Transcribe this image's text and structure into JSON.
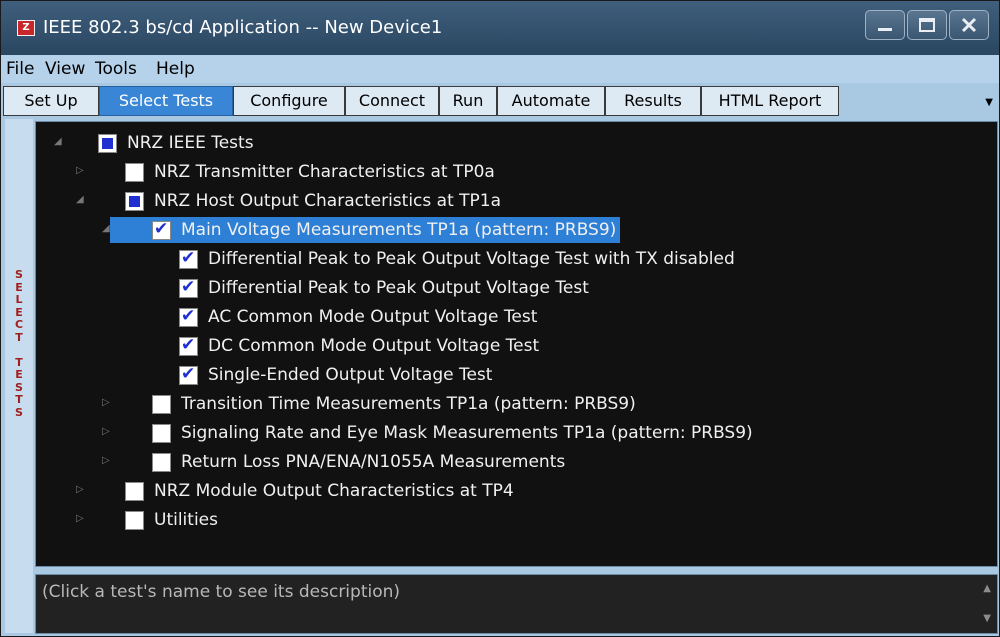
{
  "window": {
    "title": "IEEE 802.3 bs/cd Application -- New Device1",
    "app_icon_glyph": "Z"
  },
  "menu": [
    "File",
    "View",
    "Tools",
    "Help"
  ],
  "tabs": [
    {
      "label": "Set Up",
      "active": false
    },
    {
      "label": "Select Tests",
      "active": true
    },
    {
      "label": "Configure",
      "active": false
    },
    {
      "label": "Connect",
      "active": false
    },
    {
      "label": "Run",
      "active": false
    },
    {
      "label": "Automate",
      "active": false
    },
    {
      "label": "Results",
      "active": false
    },
    {
      "label": "HTML Report",
      "active": false
    }
  ],
  "sidebar_vertical_label": "SELECT TESTS",
  "tree": [
    {
      "label": "NRZ IEEE Tests",
      "state": "partial",
      "expander": "expanded",
      "selected": false
    },
    {
      "label": "NRZ Transmitter Characteristics at TP0a",
      "state": "unchecked",
      "expander": "collapsed",
      "selected": false
    },
    {
      "label": "NRZ Host Output Characteristics at TP1a",
      "state": "partial",
      "expander": "expanded",
      "selected": false
    },
    {
      "label": "Main Voltage Measurements TP1a (pattern: PRBS9)",
      "state": "checked",
      "expander": "expanded",
      "selected": true
    },
    {
      "label": "Differential Peak to Peak Output Voltage Test with TX disabled",
      "state": "checked",
      "expander": "none",
      "selected": false
    },
    {
      "label": "Differential Peak to Peak Output Voltage Test",
      "state": "checked",
      "expander": "none",
      "selected": false
    },
    {
      "label": "AC Common Mode Output Voltage Test",
      "state": "checked",
      "expander": "none",
      "selected": false
    },
    {
      "label": "DC Common Mode Output Voltage Test",
      "state": "checked",
      "expander": "none",
      "selected": false
    },
    {
      "label": "Single-Ended Output Voltage Test",
      "state": "checked",
      "expander": "none",
      "selected": false
    },
    {
      "label": "Transition Time Measurements TP1a (pattern: PRBS9)",
      "state": "unchecked",
      "expander": "collapsed",
      "selected": false
    },
    {
      "label": "Signaling Rate and Eye Mask Measurements TP1a (pattern: PRBS9)",
      "state": "unchecked",
      "expander": "collapsed",
      "selected": false
    },
    {
      "label": "Return Loss PNA/ENA/N1055A Measurements",
      "state": "unchecked",
      "expander": "collapsed",
      "selected": false
    },
    {
      "label": "NRZ Module Output Characteristics at TP4",
      "state": "unchecked",
      "expander": "collapsed",
      "selected": false
    },
    {
      "label": "Utilities",
      "state": "unchecked",
      "expander": "collapsed",
      "selected": false
    }
  ],
  "description": "(Click a test's name to see its description)",
  "icons": {
    "expanded": "◢",
    "collapsed": "▷",
    "dropdown": "▼",
    "scroll_up": "▲",
    "scroll_down": "▼"
  },
  "colors": {
    "active_tab": "#3a86d6",
    "selected_row": "#2e7fd6",
    "check_mark": "#1f2fd0",
    "tree_background": "#111111"
  }
}
